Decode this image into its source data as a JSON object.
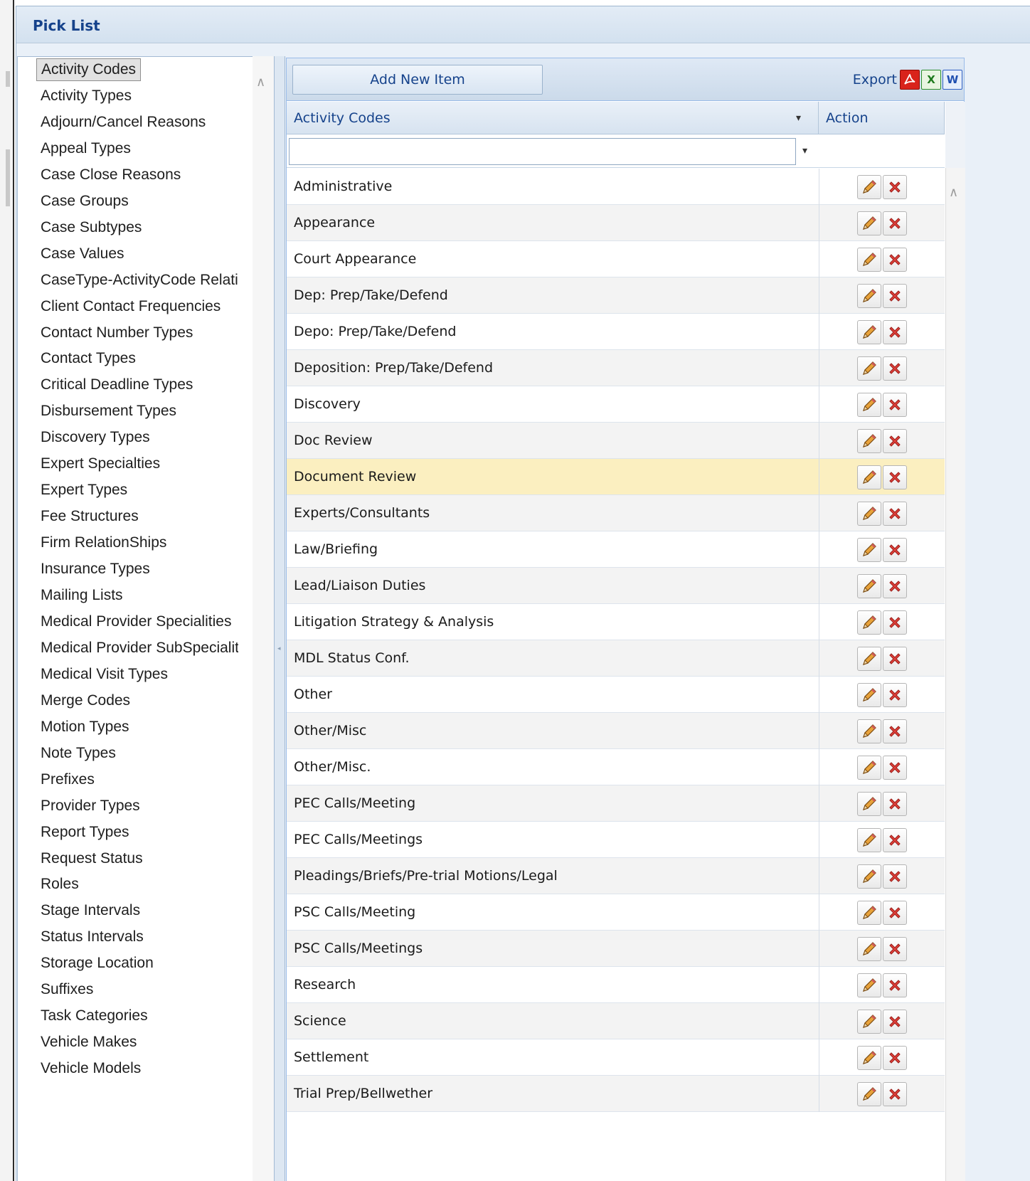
{
  "panel": {
    "title": "Pick List"
  },
  "nav": {
    "items": [
      "Activity Codes",
      "Activity Types",
      "Adjourn/Cancel Reasons",
      "Appeal Types",
      "Case Close Reasons",
      "Case Groups",
      "Case Subtypes",
      "Case Values",
      "CaseType-ActivityCode Relatio",
      "Client Contact Frequencies",
      "Contact Number Types",
      "Contact Types",
      "Critical Deadline Types",
      "Disbursement Types",
      "Discovery Types",
      "Expert Specialties",
      "Expert Types",
      "Fee Structures",
      "Firm RelationShips",
      "Insurance Types",
      "Mailing Lists",
      "Medical Provider Specialities",
      "Medical Provider SubSpecialiti",
      "Medical Visit Types",
      "Merge Codes",
      "Motion Types",
      "Note Types",
      "Prefixes",
      "Provider Types",
      "Report Types",
      "Request Status",
      "Roles",
      "Stage Intervals",
      "Status Intervals",
      "Storage Location",
      "Suffixes",
      "Task Categories",
      "Vehicle Makes",
      "Vehicle Models"
    ],
    "selected_index": 0
  },
  "toolbar": {
    "add_label": "Add New Item",
    "export_label": "Export",
    "export_icons": [
      "pdf-icon",
      "excel-icon",
      "word-icon"
    ]
  },
  "grid": {
    "columns": [
      "Activity Codes",
      "Action"
    ],
    "filter": {
      "value": ""
    },
    "highlighted_index": 8,
    "rows": [
      "Administrative",
      "Appearance",
      "Court Appearance",
      "Dep: Prep/Take/Defend",
      "Depo: Prep/Take/Defend",
      "Deposition: Prep/Take/Defend",
      "Discovery",
      "Doc Review",
      "Document Review",
      "Experts/Consultants",
      "Law/Briefing",
      "Lead/Liaison Duties",
      "Litigation Strategy & Analysis",
      "MDL Status Conf.",
      "Other",
      "Other/Misc",
      "Other/Misc.",
      "PEC Calls/Meeting",
      "PEC Calls/Meetings",
      "Pleadings/Briefs/Pre-trial Motions/Legal",
      "PSC Calls/Meeting",
      "PSC Calls/Meetings",
      "Research",
      "Science",
      "Settlement",
      "Trial Prep/Bellwether"
    ]
  },
  "colors": {
    "title_blue": "#15428b",
    "highlight_row": "#fbefc0",
    "alt_row": "#f3f3f3",
    "delete_red": "#e0403a",
    "pencil_orange": "#e8a23a"
  }
}
